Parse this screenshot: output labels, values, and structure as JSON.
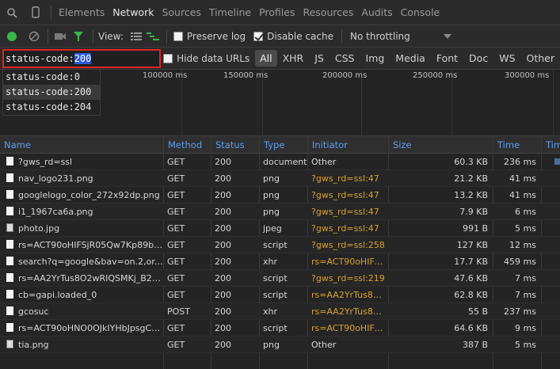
{
  "tabs": [
    {
      "label": "Elements",
      "active": false
    },
    {
      "label": "Network",
      "active": true
    },
    {
      "label": "Sources",
      "active": false
    },
    {
      "label": "Timeline",
      "active": false
    },
    {
      "label": "Profiles",
      "active": false
    },
    {
      "label": "Resources",
      "active": false
    },
    {
      "label": "Audits",
      "active": false
    },
    {
      "label": "Console",
      "active": false
    }
  ],
  "toolbar": {
    "view_label": "View:",
    "preserve_log": {
      "label": "Preserve log",
      "checked": false
    },
    "disable_cache": {
      "label": "Disable cache",
      "checked": true
    },
    "throttling": "No throttling",
    "record_color": "#39b54a",
    "filter_color": "#39b54a"
  },
  "filter": {
    "prefix": "status-code:",
    "selected": "200",
    "hide_data_urls": "Hide data URLs",
    "types": [
      "All",
      "XHR",
      "JS",
      "CSS",
      "Img",
      "Media",
      "Font",
      "Doc",
      "WS",
      "Other"
    ],
    "active_type": "All",
    "highlight_color": "#e02424"
  },
  "suggestions": [
    "status-code:0",
    "status-code:200",
    "status-code:204"
  ],
  "timeline_ticks": [
    "100000 ms",
    "150000 ms",
    "200000 ms",
    "250000 ms",
    "300000 ms"
  ],
  "columns": [
    "Name",
    "Method",
    "Status",
    "Type",
    "Initiator",
    "Size",
    "Time",
    "Timeline"
  ],
  "rows": [
    {
      "name": "?gws_rd=ssl",
      "method": "GET",
      "status": "200",
      "type": "document",
      "initiator": "Other",
      "size": "60.3 KB",
      "time": "236 ms"
    },
    {
      "name": "nav_logo231.png",
      "method": "GET",
      "status": "200",
      "type": "png",
      "initiator": "?gws_rd=ssl:47",
      "size": "21.2 KB",
      "time": "41 ms"
    },
    {
      "name": "googlelogo_color_272x92dp.png",
      "method": "GET",
      "status": "200",
      "type": "png",
      "initiator": "?gws_rd=ssl:47",
      "size": "13.2 KB",
      "time": "41 ms"
    },
    {
      "name": "i1_1967ca6a.png",
      "method": "GET",
      "status": "200",
      "type": "png",
      "initiator": "?gws_rd=ssl:47",
      "size": "7.9 KB",
      "time": "6 ms"
    },
    {
      "name": "photo.jpg",
      "method": "GET",
      "status": "200",
      "type": "jpeg",
      "initiator": "?gws_rd=ssl:47",
      "size": "991 B",
      "time": "5 ms"
    },
    {
      "name": "rs=ACT90oHIFSjR05Qw7Kp89bam…",
      "method": "GET",
      "status": "200",
      "type": "script",
      "initiator": "?gws_rd=ssl:258",
      "size": "127 KB",
      "time": "12 ms"
    },
    {
      "name": "search?q=google&bav=on.2,or.r_c…",
      "method": "GET",
      "status": "200",
      "type": "xhr",
      "initiator": "rs=ACT90oHIFSjR…",
      "size": "17.7 KB",
      "time": "459 ms"
    },
    {
      "name": "rs=AA2YrTus8O2wRIQSMKj_B28_if…",
      "method": "GET",
      "status": "200",
      "type": "script",
      "initiator": "?gws_rd=ssl:219",
      "size": "47.6 KB",
      "time": "7 ms"
    },
    {
      "name": "cb=gapi.loaded_0",
      "method": "GET",
      "status": "200",
      "type": "script",
      "initiator": "rs=AA2YrTus8O2…",
      "size": "62.8 KB",
      "time": "7 ms"
    },
    {
      "name": "gcosuc",
      "method": "POST",
      "status": "200",
      "type": "xhr",
      "initiator": "rs=AA2YrTus8O2…",
      "size": "55 B",
      "time": "237 ms"
    },
    {
      "name": "rs=ACT90oHNO0OJkIYHbJpsgCco…",
      "method": "GET",
      "status": "200",
      "type": "script",
      "initiator": "rs=ACT90oHIFSjR…",
      "size": "64.6 KB",
      "time": "9 ms"
    },
    {
      "name": "tia.png",
      "method": "GET",
      "status": "200",
      "type": "png",
      "initiator": "Other",
      "size": "387 B",
      "time": "5 ms"
    }
  ]
}
